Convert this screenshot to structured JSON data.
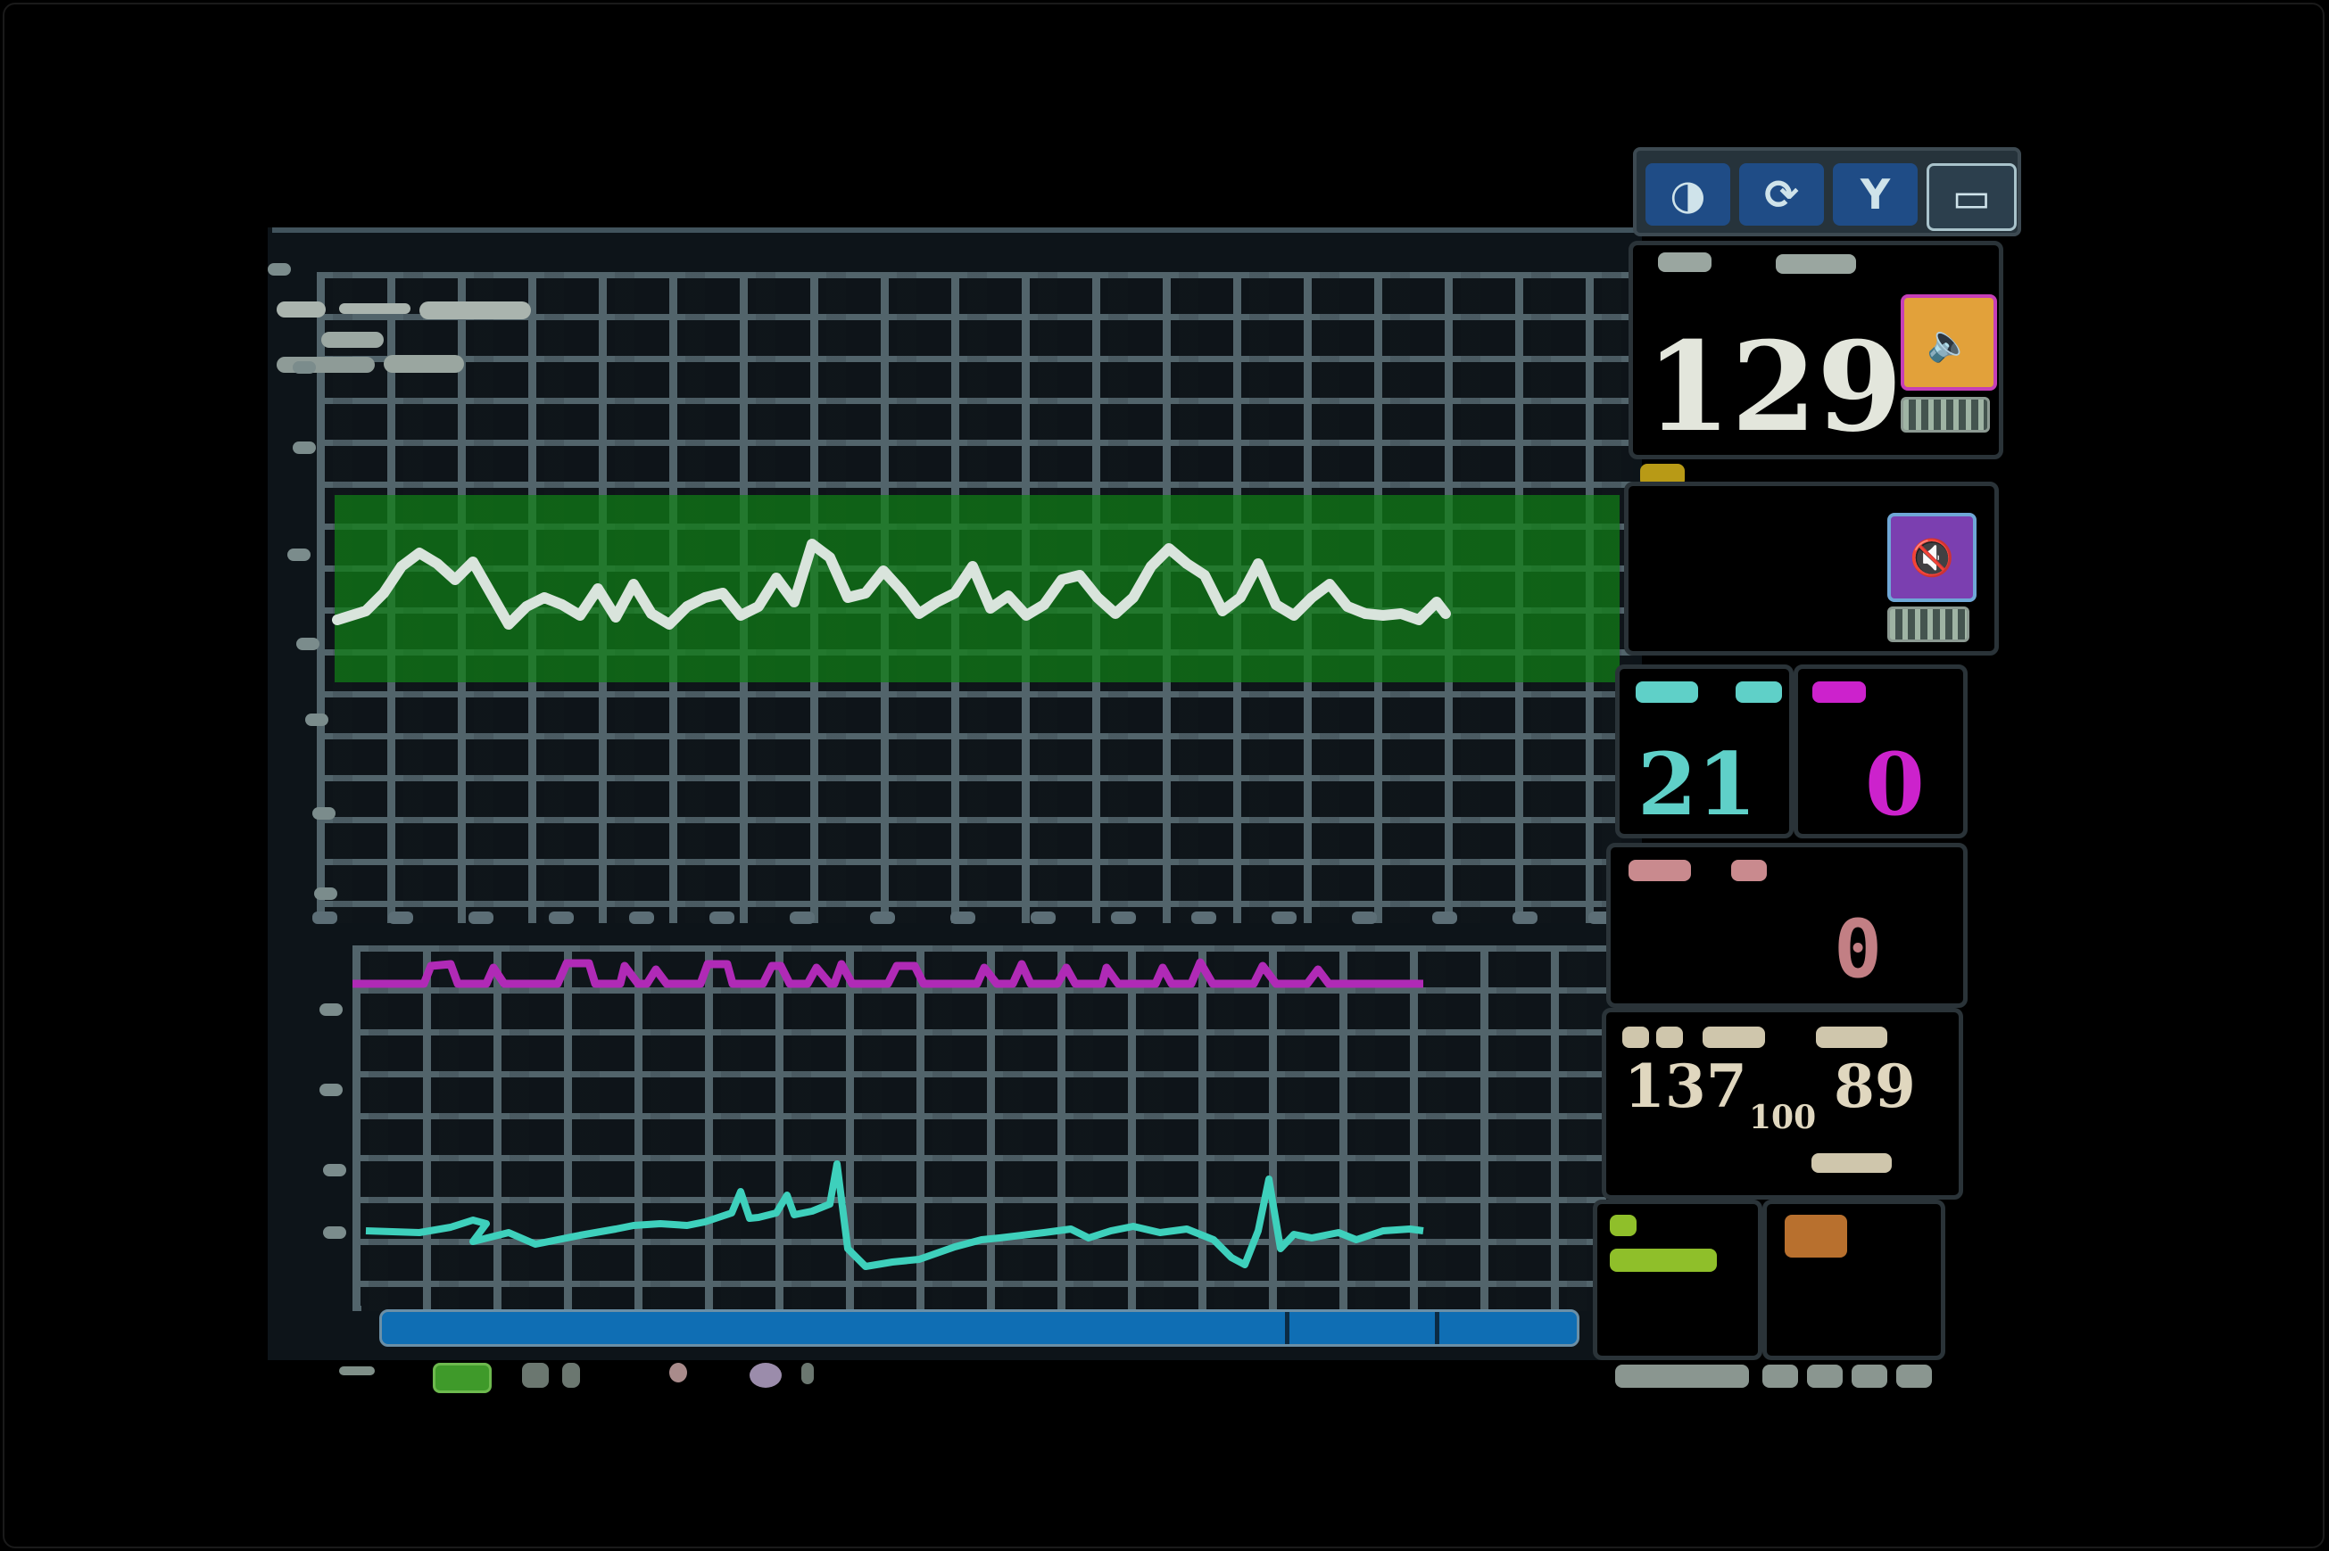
{
  "monitor": {
    "heart_rate": {
      "value": "129",
      "color": "#e3e6dc"
    },
    "resp_rate": {
      "value": "21",
      "color": "#5fd0c8"
    },
    "spo2_secondary": {
      "value": "0",
      "color": "#cc22cc"
    },
    "temp_value": {
      "value": "0",
      "color": "#c27f84"
    },
    "nibp": {
      "systolic": "137",
      "mean": "100",
      "diastolic": "89",
      "color": "#e0d7bf"
    }
  },
  "toolbar": {
    "icons": [
      "waveform-icon",
      "refresh-icon",
      "probe-icon",
      "screen-icon"
    ]
  },
  "waveforms": {
    "pleth": {
      "color": "#d9e4dc",
      "band_color": "#118016"
    },
    "co2": {
      "color": "#b02ab6"
    },
    "ecg": {
      "color": "#3ed0bc"
    }
  },
  "colors": {
    "accent_blue": "#1f4c86",
    "alarm_orange": "#e2a13a",
    "alarm_purple": "#7b3fb0",
    "grid": "#52646b",
    "progress": "#0f6eb4"
  }
}
